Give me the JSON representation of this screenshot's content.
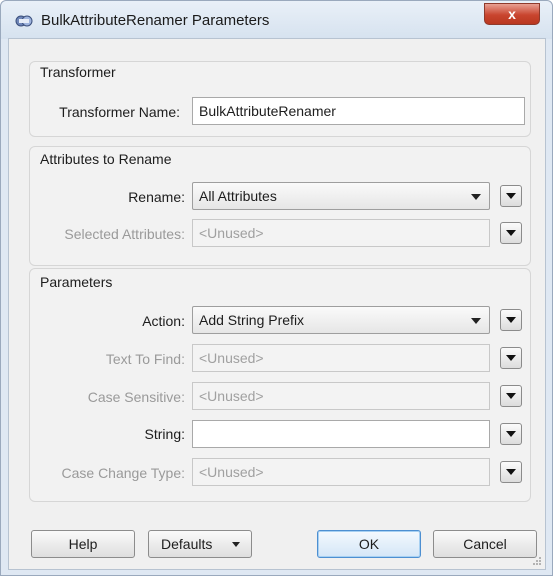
{
  "window": {
    "title": "BulkAttributeRenamer Parameters",
    "close_glyph": "x"
  },
  "transformer": {
    "group_title": "Transformer",
    "name_label": "Transformer Name:",
    "name_value": "BulkAttributeRenamer"
  },
  "attributes": {
    "group_title": "Attributes to Rename",
    "rename_label": "Rename:",
    "rename_value": "All Attributes",
    "selected_label": "Selected Attributes:",
    "selected_value": "<Unused>"
  },
  "parameters": {
    "group_title": "Parameters",
    "action_label": "Action:",
    "action_value": "Add String Prefix",
    "text_to_find_label": "Text To Find:",
    "text_to_find_value": "<Unused>",
    "case_sensitive_label": "Case Sensitive:",
    "case_sensitive_value": "<Unused>",
    "string_label": "String:",
    "string_value": "",
    "case_change_label": "Case Change Type:",
    "case_change_value": "<Unused>"
  },
  "footer": {
    "help": "Help",
    "defaults": "Defaults",
    "ok": "OK",
    "cancel": "Cancel"
  },
  "icons": {
    "app": "fme-transformer-icon",
    "dropdown": "chevron-down-icon",
    "close": "close-icon"
  }
}
